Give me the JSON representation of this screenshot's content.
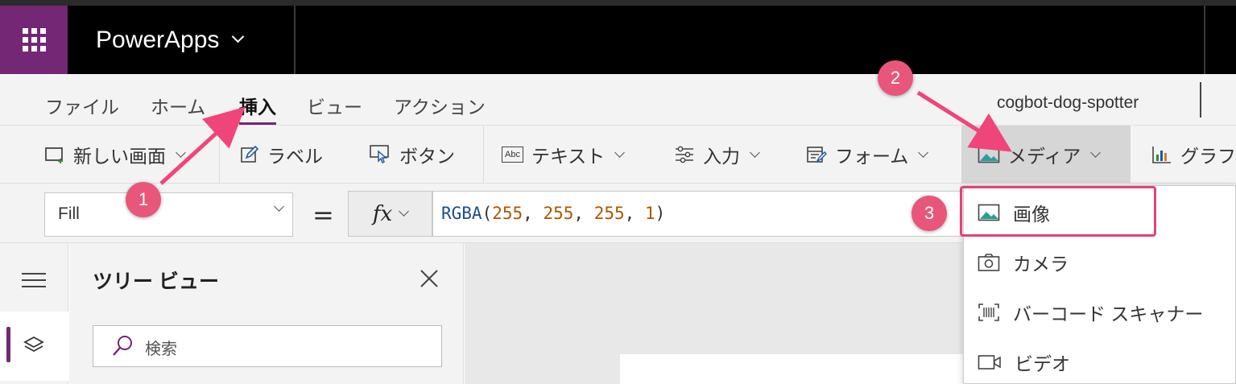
{
  "app": {
    "name": "PowerApps",
    "file_name": "cogbot-dog-spotter"
  },
  "menu": {
    "tabs": [
      {
        "label": "ファイル"
      },
      {
        "label": "ホーム"
      },
      {
        "label": "挿入",
        "active": true
      },
      {
        "label": "ビュー"
      },
      {
        "label": "アクション"
      }
    ]
  },
  "ribbon": {
    "new_screen": "新しい画面",
    "label": "ラベル",
    "button": "ボタン",
    "text": "テキスト",
    "input": "入力",
    "form": "フォーム",
    "media": "メディア",
    "chart": "グラフ",
    "text_icon_text": "Abc"
  },
  "formula_bar": {
    "property": "Fill",
    "equals": "=",
    "fx": "fx",
    "formula": {
      "fn": "RGBA",
      "args": [
        "255",
        "255",
        "255",
        "1"
      ]
    }
  },
  "tree_view": {
    "title": "ツリー ビュー",
    "search_placeholder": "検索"
  },
  "media_menu": {
    "items": [
      {
        "label": "画像",
        "icon": "image-icon",
        "highlighted": true
      },
      {
        "label": "カメラ",
        "icon": "camera-icon"
      },
      {
        "label": "バーコード スキャナー",
        "icon": "barcode-icon"
      },
      {
        "label": "ビデオ",
        "icon": "video-icon"
      }
    ]
  },
  "annotations": {
    "step1": "1",
    "step2": "2",
    "step3": "3",
    "arrow_color": "#f0457a"
  },
  "colors": {
    "brand": "#742774",
    "highlight": "#e6407a",
    "badge": "#e8567a"
  }
}
